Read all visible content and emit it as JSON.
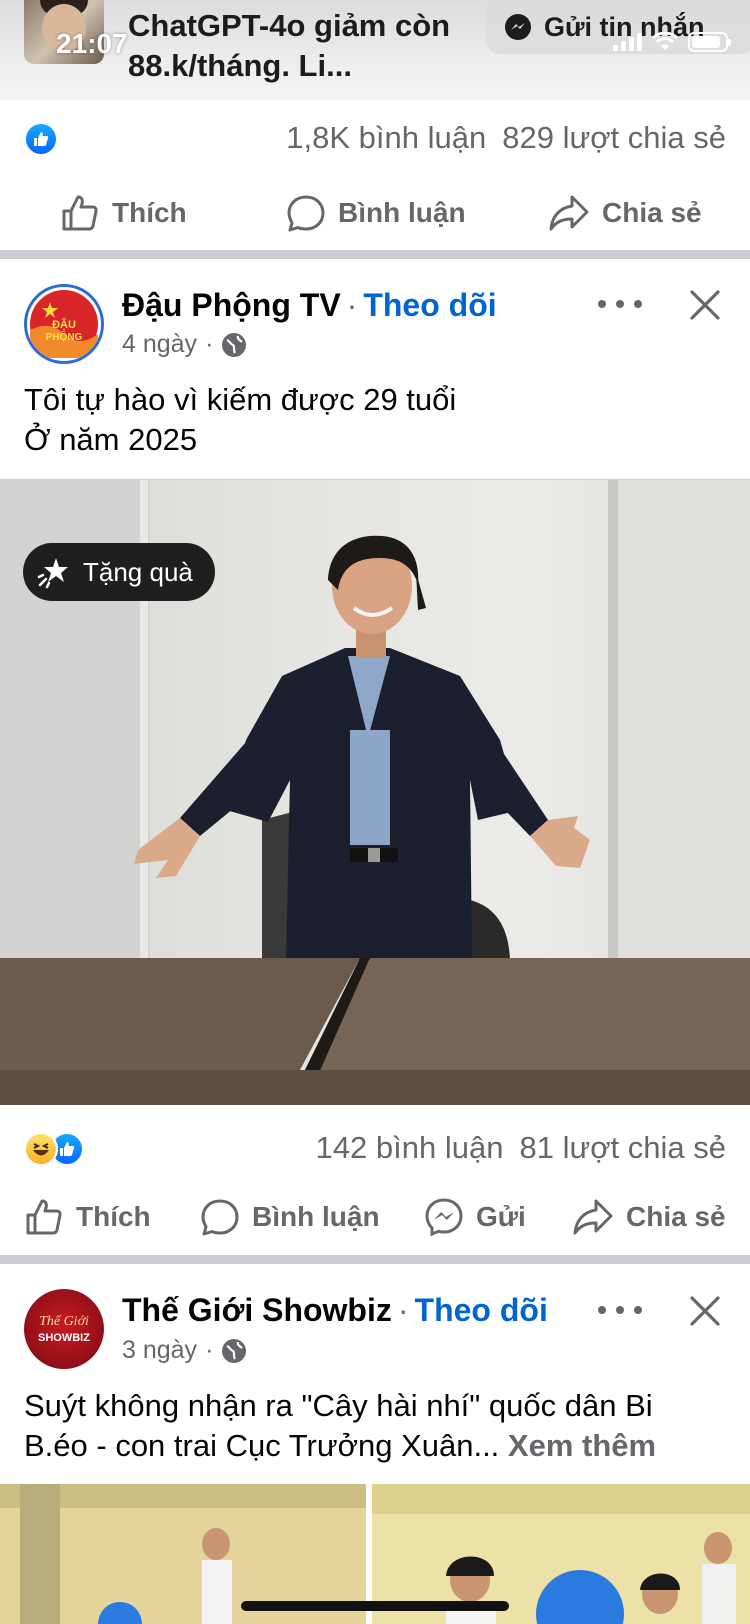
{
  "status_bar": {
    "time": "21:07"
  },
  "top_post": {
    "title": "ChatGPT-4o giảm còn 88.k/tháng. Li...",
    "message_button": "Gửi tin nhắn",
    "stats": {
      "comments": "1,8K bình luận",
      "shares": "829 lượt chia sẻ"
    },
    "actions": {
      "like": "Thích",
      "comment": "Bình luận",
      "share": "Chia sẻ"
    }
  },
  "post1": {
    "page_name": "Đậu Phộng TV",
    "separator": "·",
    "follow_label": "Theo dõi",
    "time": "4 ngày",
    "meta_separator": "·",
    "avatar_text": "ĐẬU PHỘNG",
    "text_line1": "Tôi tự hào vì kiếm được 29 tuổi",
    "text_line2": "Ở năm 2025",
    "gift_label": "Tặng quà",
    "stats": {
      "comments": "142 bình luận",
      "shares": "81 lượt chia sẻ"
    },
    "actions": {
      "like": "Thích",
      "comment": "Bình luận",
      "send": "Gửi",
      "share": "Chia sẻ"
    }
  },
  "post2": {
    "page_name": "Thế Giới Showbiz",
    "separator": "·",
    "follow_label": "Theo dõi",
    "time": "3 ngày",
    "meta_separator": "·",
    "avatar_text_1": "Thế Giới",
    "avatar_text_2": "SHOWBIZ",
    "text": "Suýt không nhận ra \"Cây hài nhí\" quốc dân Bi B.éo - con trai Cục Trưởng Xuân...",
    "see_more": "Xem thêm"
  },
  "colors": {
    "facebook_blue": "#0866ff",
    "follow_blue": "#0064d1",
    "secondary_text": "#65676b",
    "divider": "#c9ccd1"
  }
}
